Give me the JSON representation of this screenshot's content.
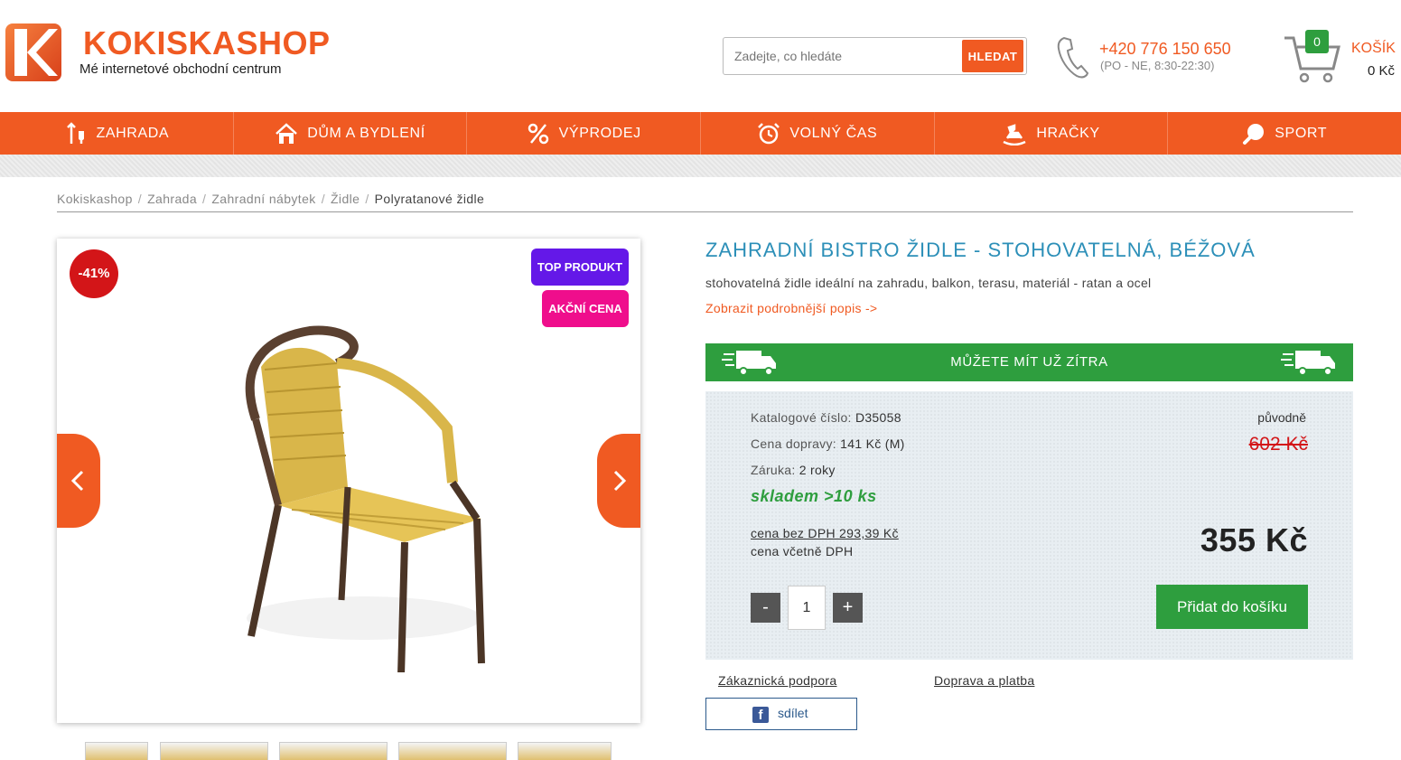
{
  "header": {
    "logo_title": "KOKISKASHOP",
    "logo_subtitle": "Mé internetové obchodní centrum",
    "search_placeholder": "Zadejte, co hledáte",
    "search_button": "HLEDAT",
    "phone": "+420 776 150 650",
    "hours": "(PO - NE, 8:30-22:30)",
    "cart_count": "0",
    "cart_label": "KOŠÍK",
    "cart_total": "0 Kč"
  },
  "nav": [
    {
      "label": "ZAHRADA",
      "icon": "garden-icon"
    },
    {
      "label": "DŮM A BYDLENÍ",
      "icon": "house-icon"
    },
    {
      "label": "VÝPRODEJ",
      "icon": "percent-icon"
    },
    {
      "label": "VOLNÝ ČAS",
      "icon": "alarm-clock-icon"
    },
    {
      "label": "HRAČKY",
      "icon": "rocking-horse-icon"
    },
    {
      "label": "SPORT",
      "icon": "ping-pong-icon"
    }
  ],
  "breadcrumb": [
    "Kokiskashop",
    "Zahrada",
    "Zahradní nábytek",
    "Židle",
    "Polyratanové židle"
  ],
  "gallery": {
    "discount": "-41%",
    "badge_top": "TOP PRODUKT",
    "badge_sale": "AKČNÍ CENA"
  },
  "product": {
    "title": "ZAHRADNÍ BISTRO ŽIDLE - STOHOVATELNÁ, BÉŽOVÁ",
    "description": "stohovatelná židle ideální na zahradu, balkon, terasu, materiál - ratan a ocel",
    "more_link": "Zobrazit podrobnější popis ->",
    "delivery": "MŮŽETE MÍT UŽ ZÍTRA",
    "catalog_label": "Katalogové číslo:",
    "catalog_value": "D35058",
    "shipping_label": "Cena dopravy:",
    "shipping_value": "141 Kč (M)",
    "warranty_label": "Záruka:",
    "warranty_value": "2 roky",
    "stock": "skladem >10 ks",
    "price_no_vat": "cena bez DPH 293,39 Kč",
    "price_with_vat_label": "cena včetně DPH",
    "original_label": "původně",
    "original_price": "602 Kč",
    "price": "355 Kč",
    "qty_minus": "-",
    "qty_value": "1",
    "qty_plus": "+",
    "add_to_cart": "Přidat do košíku",
    "support_link": "Zákaznická podpora",
    "shipping_link": "Doprava a platba",
    "share_label": "sdílet"
  },
  "colors": {
    "brand": "#f05a22",
    "green": "#2e9e3e",
    "title_blue": "#2c8fb8",
    "badge_purple": "#6418e8",
    "badge_pink": "#ef0e8c",
    "discount_red": "#d31518"
  }
}
